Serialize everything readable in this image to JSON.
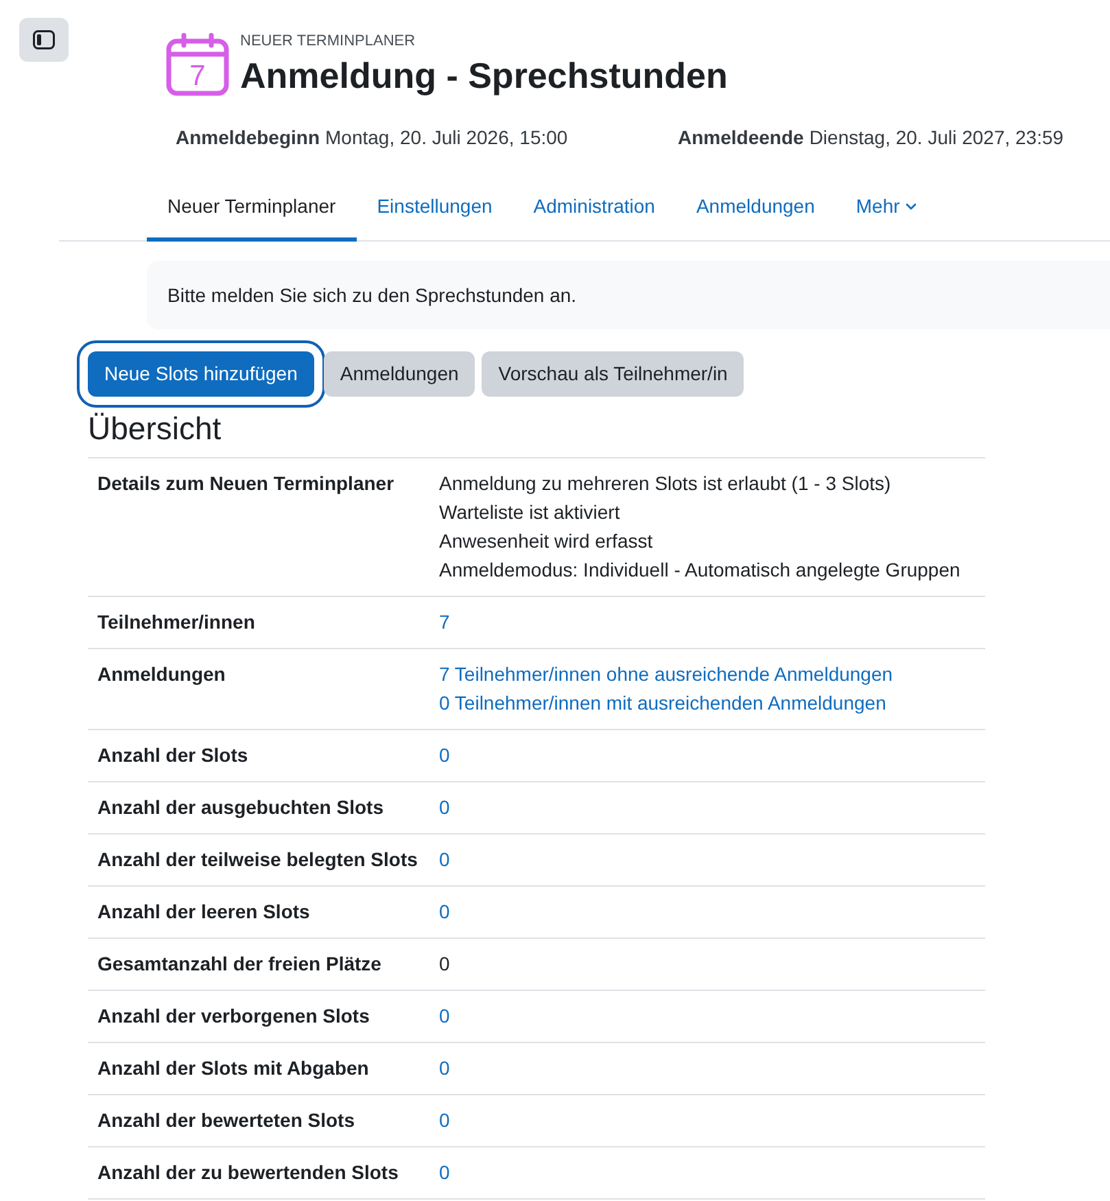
{
  "header": {
    "kicker": "NEUER TERMINPLANER",
    "title": "Anmeldung - Sprechstunden",
    "calendar_day": "7"
  },
  "dates": [
    {
      "label": "Anmeldebeginn",
      "value": "Montag, 20. Juli 2026, 15:00"
    },
    {
      "label": "Anmeldeende",
      "value": "Dienstag, 20. Juli 2027, 23:59"
    }
  ],
  "tabs": [
    {
      "label": "Neuer Terminplaner",
      "selected": true,
      "kind": "link"
    },
    {
      "label": "Einstellungen",
      "selected": false,
      "kind": "link"
    },
    {
      "label": "Administration",
      "selected": false,
      "kind": "link"
    },
    {
      "label": "Anmeldungen",
      "selected": false,
      "kind": "link"
    },
    {
      "label": "Mehr",
      "selected": false,
      "kind": "menu"
    }
  ],
  "notice": "Bitte melden Sie sich zu den Sprechstunden an.",
  "buttons": [
    {
      "label": "Neue Slots hinzufügen",
      "kind": "primary",
      "focused": true
    },
    {
      "label": "Anmeldungen",
      "kind": "secondary",
      "focused": false
    },
    {
      "label": "Vorschau als Teilnehmer/in",
      "kind": "secondary",
      "focused": false
    }
  ],
  "overview": {
    "heading": "Übersicht",
    "rows": [
      {
        "label": "Details zum Neuen Terminplaner",
        "values": [
          {
            "text": "Anmeldung zu mehreren Slots ist erlaubt (1 - 3 Slots)",
            "kind": "text"
          },
          {
            "text": "Warteliste ist aktiviert",
            "kind": "text"
          },
          {
            "text": "Anwesenheit wird erfasst",
            "kind": "text"
          },
          {
            "text": "Anmeldemodus: Individuell - Automatisch angelegte Gruppen",
            "kind": "text"
          }
        ]
      },
      {
        "label": "Teilnehmer/innen",
        "values": [
          {
            "text": "7",
            "kind": "link"
          }
        ]
      },
      {
        "label": "Anmeldungen",
        "values": [
          {
            "text": "7 Teilnehmer/innen ohne ausreichende Anmeldungen",
            "kind": "link"
          },
          {
            "text": "0 Teilnehmer/innen mit ausreichenden Anmeldungen",
            "kind": "link"
          }
        ]
      },
      {
        "label": "Anzahl der Slots",
        "values": [
          {
            "text": "0",
            "kind": "link"
          }
        ]
      },
      {
        "label": "Anzahl der ausgebuchten Slots",
        "values": [
          {
            "text": "0",
            "kind": "link"
          }
        ]
      },
      {
        "label": "Anzahl der teilweise belegten Slots",
        "values": [
          {
            "text": "0",
            "kind": "link"
          }
        ]
      },
      {
        "label": "Anzahl der leeren Slots",
        "values": [
          {
            "text": "0",
            "kind": "link"
          }
        ]
      },
      {
        "label": "Gesamtanzahl der freien Plätze",
        "values": [
          {
            "text": "0",
            "kind": "text"
          }
        ]
      },
      {
        "label": "Anzahl der verborgenen Slots",
        "values": [
          {
            "text": "0",
            "kind": "link"
          }
        ]
      },
      {
        "label": "Anzahl der Slots mit Abgaben",
        "values": [
          {
            "text": "0",
            "kind": "link"
          }
        ]
      },
      {
        "label": "Anzahl der bewerteten Slots",
        "values": [
          {
            "text": "0",
            "kind": "link"
          }
        ]
      },
      {
        "label": "Anzahl der zu bewertenden Slots",
        "values": [
          {
            "text": "0",
            "kind": "link"
          }
        ]
      }
    ]
  }
}
